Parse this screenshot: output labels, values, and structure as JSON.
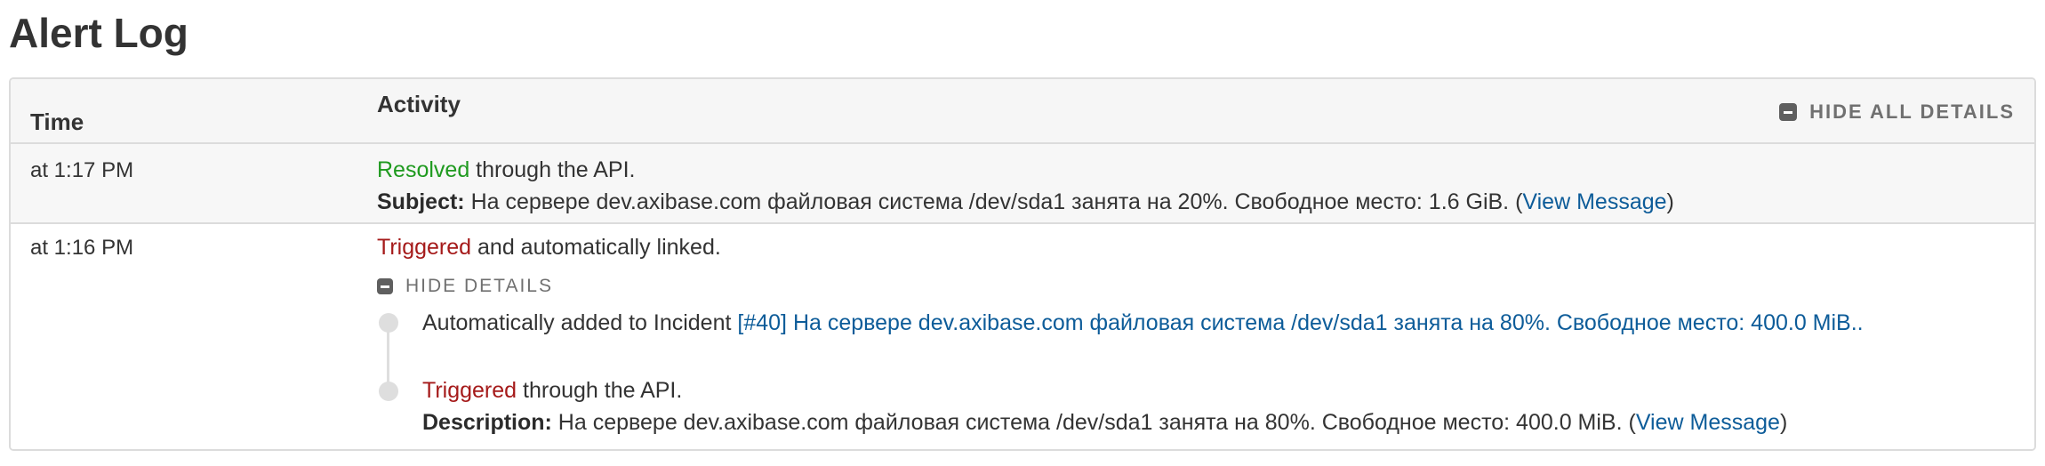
{
  "page": {
    "title": "Alert Log"
  },
  "table": {
    "header": {
      "time": "Time",
      "activity": "Activity",
      "hide_all_details": "HIDE ALL DETAILS"
    },
    "rows": [
      {
        "time": "at 1:17 PM",
        "status": "Resolved",
        "status_rest": " through the API.",
        "subject_label": "Subject:",
        "subject_text": " На сервере dev.axibase.com файловая система /dev/sda1 занята на 20%. Свободное место: 1.6 GiB. (",
        "view_message": "View Message",
        "close_paren": ")"
      },
      {
        "time": "at 1:16 PM",
        "status": "Triggered",
        "status_rest": " and automatically linked.",
        "hide_details": "HIDE DETAILS",
        "details": [
          {
            "text": "Automatically added to Incident ",
            "incident_link": "[#40] На сервере dev.axibase.com файловая система /dev/sda1 занята на 80%. Свободное место: 400.0 MiB.."
          },
          {
            "status": "Triggered",
            "status_rest": " through the API.",
            "description_label": "Description:",
            "description_text": " На сервере dev.axibase.com файловая система /dev/sda1 занята на 80%. Свободное место: 400.0 MiB. (",
            "view_message": "View Message",
            "close_paren": ")"
          }
        ]
      }
    ]
  },
  "colors": {
    "resolved": "#1f9a1f",
    "triggered": "#a51a1a",
    "link": "#0d5c99"
  },
  "icons": {
    "hide_all": "minus-square-icon",
    "hide_details": "minus-square-icon",
    "timeline": "timeline-dot-icon"
  }
}
